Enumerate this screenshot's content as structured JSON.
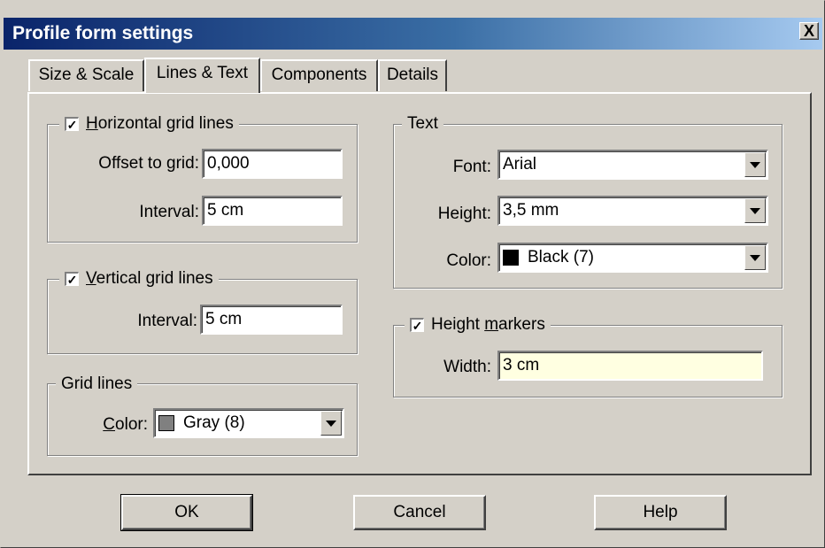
{
  "window": {
    "title": "Profile form settings",
    "close_glyph": "X"
  },
  "tabs": [
    {
      "label": "Size & Scale"
    },
    {
      "label": "Lines & Text"
    },
    {
      "label": "Components"
    },
    {
      "label": "Details"
    }
  ],
  "horizontal_grid": {
    "checkbox_label_accel": "H",
    "checkbox_label_rest": "orizontal grid lines",
    "checked": true,
    "offset_label": "Offset to grid:",
    "offset_value": "0,000",
    "interval_label": "Interval:",
    "interval_value": "5 cm"
  },
  "vertical_grid": {
    "checkbox_label_accel": "V",
    "checkbox_label_rest": "ertical grid lines",
    "checked": true,
    "interval_label": "Interval:",
    "interval_value": "5 cm"
  },
  "grid_lines": {
    "legend": "Grid lines",
    "color_label_accel": "C",
    "color_label_rest": "olor:",
    "color_value": "Gray (8)",
    "swatch_color": "#808080"
  },
  "text": {
    "legend": "Text",
    "font_label": "Font:",
    "font_value": "Arial",
    "height_label": "Height:",
    "height_value": "3,5 mm",
    "color_label": "Color:",
    "color_value": "Black (7)",
    "swatch_color": "#000000"
  },
  "height_markers": {
    "checkbox_label_pre": "Height ",
    "checkbox_label_accel": "m",
    "checkbox_label_rest": "arkers",
    "checked": true,
    "width_label": "Width:",
    "width_value": "3 cm"
  },
  "buttons": {
    "ok": "OK",
    "cancel": "Cancel",
    "help": "Help"
  },
  "check_glyph": "✓",
  "colors": {
    "face": "#d4d0c8",
    "title_start": "#0a246a",
    "title_end": "#a6caf0",
    "highlight_field": "#ffffe1"
  }
}
